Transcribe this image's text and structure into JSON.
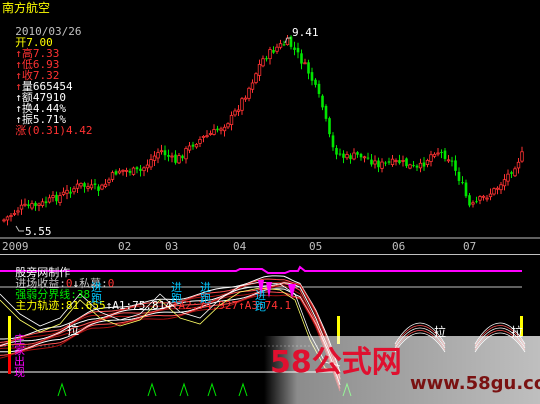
{
  "app": {
    "stock_name": "南方航空"
  },
  "info_bar": {
    "date": "2010/03/26",
    "open_label": "开",
    "open": "7.00",
    "high_label": "高",
    "high": "7.33",
    "low_label": "低",
    "low": "6.93",
    "close_label": "收",
    "close": "7.32",
    "volume_label": "量",
    "volume": "665454",
    "amount_label": "额",
    "amount": "47910",
    "turnover_label": "换",
    "turnover": "4.44%",
    "amplitude_label": "振",
    "amplitude": "5.71%",
    "change_label": "涨",
    "change": "(0.31)4.42"
  },
  "price_annotations": {
    "high_mark": "9.41",
    "low_mark": "5.55"
  },
  "time_axis": {
    "labels": [
      "2009",
      "02",
      "03",
      "04",
      "05",
      "06",
      "07"
    ]
  },
  "indicator_header": {
    "name": "股旁网制作",
    "entry_label": "进场收益:",
    "entry_value": "0",
    "private_label": "私募:",
    "private_value": "0",
    "boundary_label": "强弱分界线:",
    "boundary_value": "38",
    "main_label": "主力轨迹:",
    "main_value": "81.655",
    "a1_label": "A1:",
    "a1_value": "75.814",
    "a2_label": "A2:",
    "a2_value": "74.927",
    "a3_label": "A3:",
    "a3_value": "74.1"
  },
  "signals": {
    "entry": "进",
    "run": "跑",
    "pull": "拉",
    "dealer_appear": [
      "庄",
      "家",
      "出",
      "现"
    ]
  },
  "watermark": {
    "brand": "58公式网",
    "url": "www.58gu.com"
  },
  "colors": {
    "up": "#ff3232",
    "down": "#00e600",
    "yellow": "#ffff00",
    "magenta": "#ff00ff",
    "cyan": "#00c8ff",
    "label": "#c0c0c0",
    "white": "#ffffff"
  },
  "chart_data": {
    "type": "candlestick",
    "symbol": "南方航空",
    "yrange": [
      5.3,
      9.7
    ],
    "x_ticks": [
      "2009",
      "02",
      "03",
      "04",
      "05",
      "06",
      "07"
    ],
    "highest": 9.41,
    "lowest": 5.55,
    "last": {
      "date": "2010/03/26",
      "open": 7.0,
      "high": 7.33,
      "low": 6.93,
      "close": 7.32
    },
    "indicator": {
      "name": "股旁网制作",
      "进场收益": 0,
      "私募": 0,
      "强弱分界线": 38,
      "主力轨迹": 81.655,
      "A1": 75.814,
      "A2": 74.927,
      "A3": 74.1,
      "yrange": [
        0,
        100
      ]
    }
  }
}
